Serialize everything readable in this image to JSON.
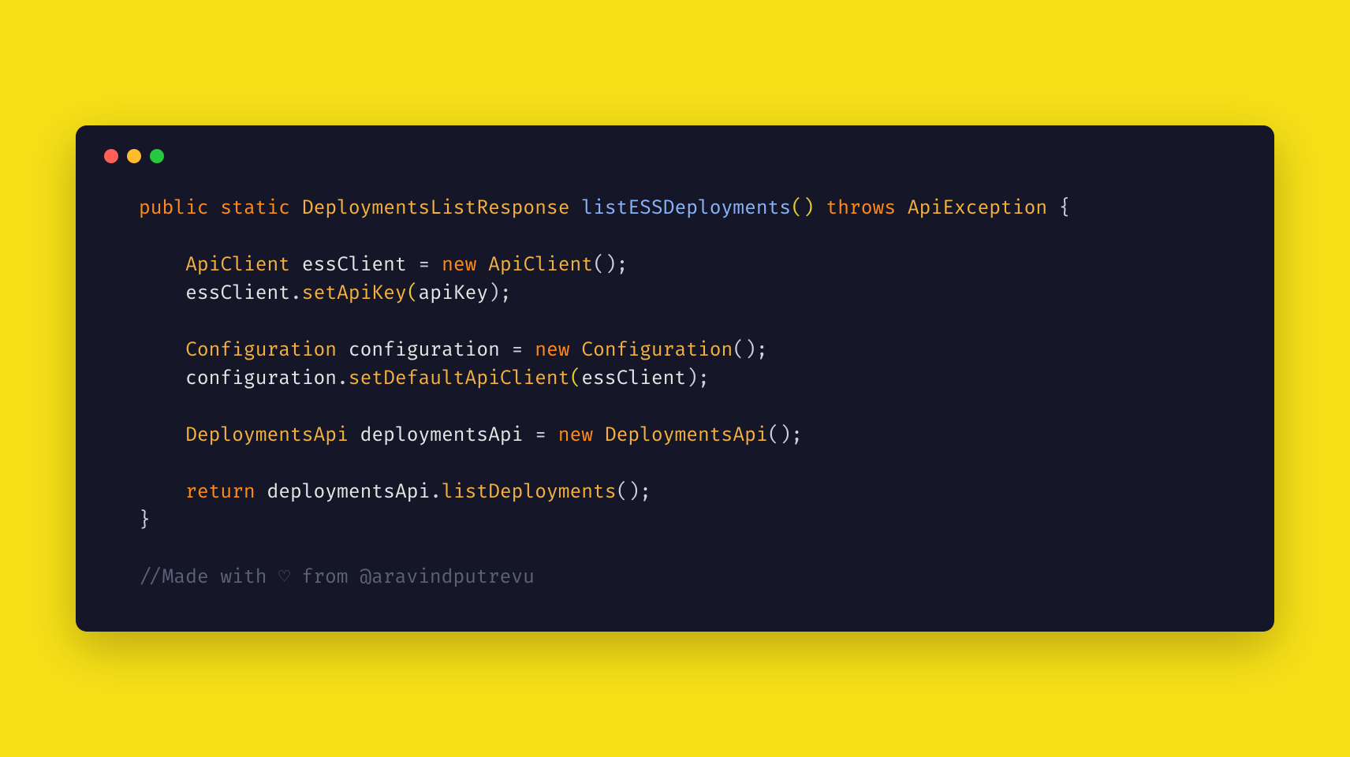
{
  "code": {
    "line1": {
      "kw1": "public",
      "kw2": "static",
      "type1": "DeploymentsListResponse",
      "fn": "listESSDeployments",
      "paren": "()",
      "kw3": "throws",
      "type2": "ApiException",
      "brace": "{"
    },
    "line3": {
      "type": "ApiClient",
      "var": "essClient",
      "eq": "=",
      "kw": "new",
      "ctor": "ApiClient",
      "tail": "();"
    },
    "line4": {
      "obj": "essClient",
      "dot": ".",
      "method": "setApiKey",
      "open": "(",
      "arg": "apiKey",
      "close": ");"
    },
    "line6": {
      "type": "Configuration",
      "var": "configuration",
      "eq": "=",
      "kw": "new",
      "ctor": "Configuration",
      "tail": "();"
    },
    "line7": {
      "obj": "configuration",
      "dot": ".",
      "method": "setDefaultApiClient",
      "open": "(",
      "arg": "essClient",
      "close": ");"
    },
    "line9": {
      "type": "DeploymentsApi",
      "var": "deploymentsApi",
      "eq": "=",
      "kw": "new",
      "ctor": "DeploymentsApi",
      "tail": "();"
    },
    "line11": {
      "kw": "return",
      "obj": "deploymentsApi",
      "dot": ".",
      "method": "listDeployments",
      "tail": "();"
    },
    "line12": {
      "brace": "}"
    },
    "comment": "//Made with ♡ from @aravindputrevu"
  }
}
